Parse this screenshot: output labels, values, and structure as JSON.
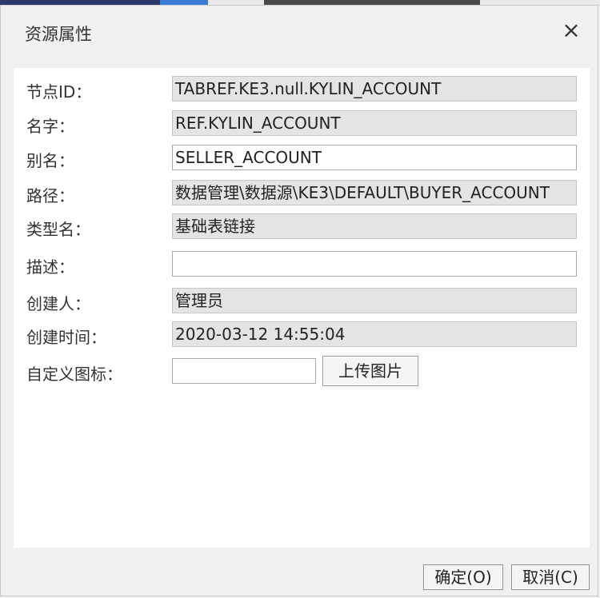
{
  "dialog": {
    "title": "资源属性",
    "close_icon": "close-icon",
    "close_glyph": "×"
  },
  "fields": [
    {
      "label": "节点ID：",
      "value": "TABREF.KE3.null.KYLIN_ACCOUNT",
      "editable": false
    },
    {
      "label": "名字：",
      "value": "REF.KYLIN_ACCOUNT",
      "editable": false
    },
    {
      "label": "别名：",
      "value": "SELLER_ACCOUNT",
      "editable": true
    },
    {
      "label": "路径：",
      "value": "数据管理\\数据源\\KE3\\DEFAULT\\BUYER_ACCOUNT",
      "editable": false
    },
    {
      "label": "类型名：",
      "value": "基础表链接",
      "editable": false
    },
    {
      "label": "描述：",
      "value": "",
      "editable": true
    },
    {
      "label": "创建人：",
      "value": "管理员",
      "editable": false
    },
    {
      "label": "创建时间：",
      "value": "2020-03-12 14:55:04",
      "editable": false
    },
    {
      "label": "自定义图标：",
      "value": "",
      "editable": true
    }
  ],
  "upload_button": "上传图片",
  "buttons": {
    "ok": "确定(O)",
    "cancel": "取消(C)"
  }
}
